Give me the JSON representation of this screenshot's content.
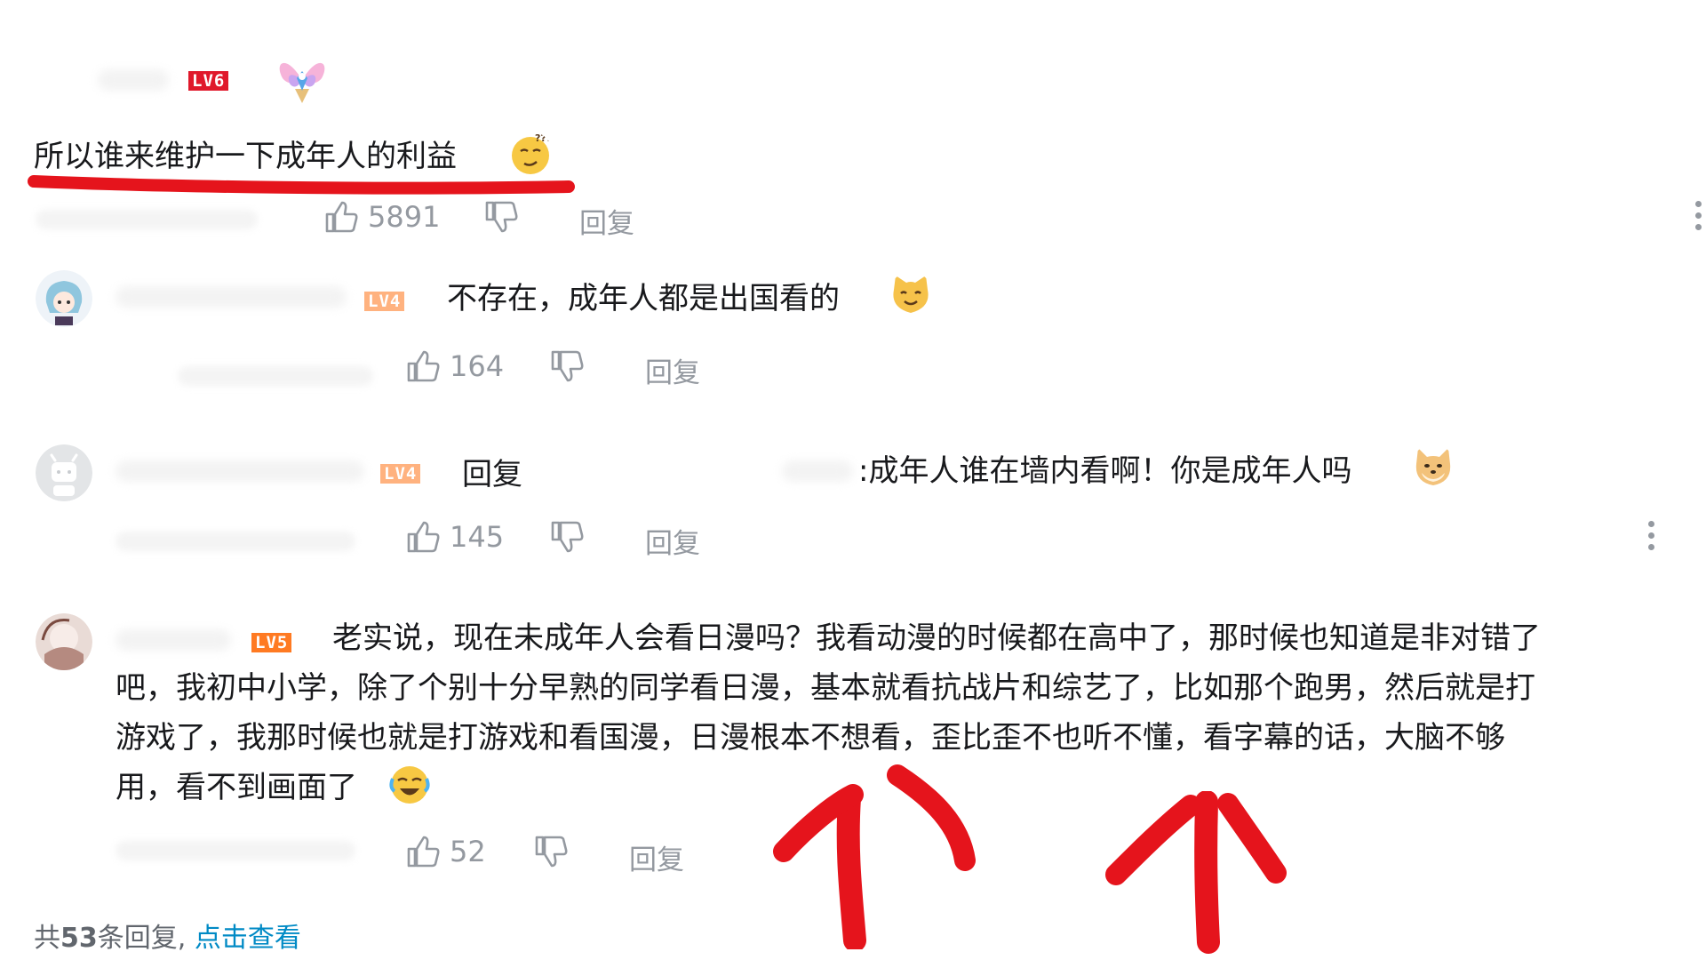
{
  "comments": [
    {
      "level": "LV6",
      "text": "所以谁来维护一下成年人的利益",
      "emoji": "thinking-face-emoji",
      "likes": "5891",
      "reply": "回复"
    },
    {
      "level": "LV4",
      "text": "不存在，成年人都是出国看的",
      "emoji": "cat-face-emoji",
      "likes": "164",
      "reply": "回复"
    },
    {
      "level": "LV4",
      "reply_label": "回复",
      "text": ":成年人谁在墙内看啊！你是成年人吗",
      "emoji": "doge-emoji",
      "likes": "145",
      "reply": "回复"
    },
    {
      "level": "LV5",
      "text_lines": [
        "老实说，现在未成年人会看日漫吗？我看动漫的时候都在高中了，那时候也知道是非对错了",
        "吧，我初中小学，除了个别十分早熟的同学看日漫，基本就看抗战片和综艺了，比如那个跑男，然后就是打",
        "游戏了，我那时候也就是打游戏和看国漫，日漫根本不想看，歪比歪不也听不懂，看字幕的话，大脑不够",
        "用，看不到画面了"
      ],
      "emoji": "crying-laughing-emoji",
      "likes": "52",
      "reply": "回复"
    }
  ],
  "footer": {
    "prefix": "共",
    "count": "53",
    "suffix": "条回复,",
    "link": "点击查看"
  },
  "colors": {
    "annotation_red": "#e5141c",
    "muted_gray": "#9499a0",
    "link_blue": "#008ac5"
  }
}
